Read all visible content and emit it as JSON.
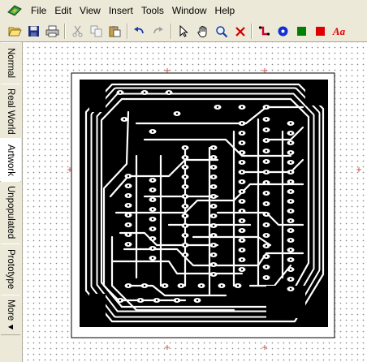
{
  "menu": {
    "items": [
      "File",
      "Edit",
      "View",
      "Insert",
      "Tools",
      "Window",
      "Help"
    ]
  },
  "toolbar": {
    "tools": [
      {
        "name": "open-icon"
      },
      {
        "name": "save-icon"
      },
      {
        "name": "print-icon"
      },
      {
        "name": "cut-icon"
      },
      {
        "name": "copy-icon"
      },
      {
        "name": "paste-icon"
      },
      {
        "name": "undo-icon"
      },
      {
        "name": "redo-icon"
      },
      {
        "name": "select-arrow-icon"
      },
      {
        "name": "hand-pan-icon"
      },
      {
        "name": "zoom-icon"
      },
      {
        "name": "delete-x-icon"
      },
      {
        "name": "wire-tool-icon"
      },
      {
        "name": "via-tool-icon"
      },
      {
        "name": "pad-tool-icon"
      },
      {
        "name": "fill-tool-icon"
      }
    ],
    "text_tool_label": "Aa"
  },
  "sidetabs": {
    "tabs": [
      "Normal",
      "Real World",
      "Artwork",
      "Unpopulated",
      "Prototype",
      "More"
    ],
    "active": "Artwork",
    "more_arrow": "◀"
  },
  "colors": {
    "wire": "#cc0033",
    "via": "#1030d0",
    "pad": "#008000",
    "fill": "#e00000",
    "delete": "#cc0000"
  }
}
